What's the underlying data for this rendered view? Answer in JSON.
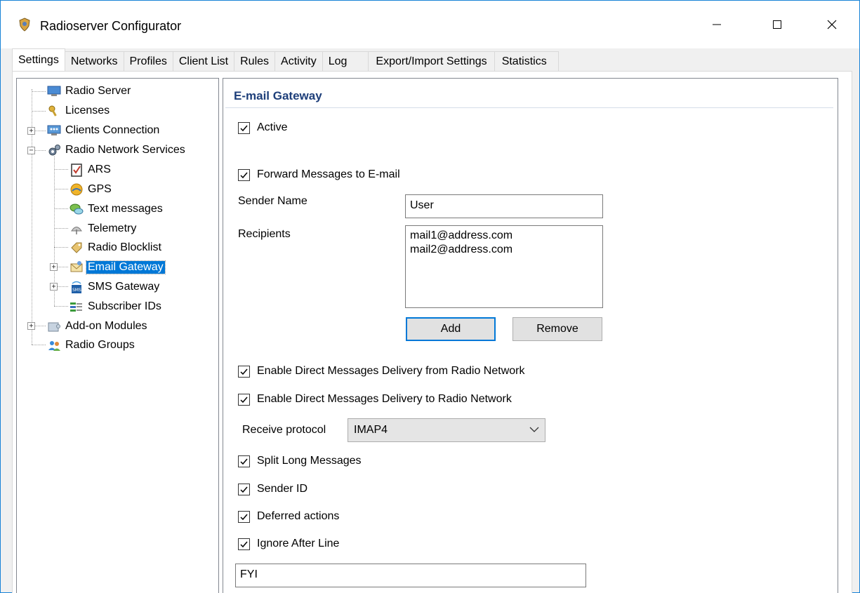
{
  "window": {
    "title": "Radioserver Configurator"
  },
  "tabs": [
    "Settings",
    "Networks",
    "Profiles",
    "Client List",
    "Rules",
    "Activity",
    "Log",
    "Export/Import Settings",
    "Statistics"
  ],
  "tree": {
    "radio_server": "Radio Server",
    "licenses": "Licenses",
    "clients_connection": "Clients Connection",
    "radio_network_services": "Radio Network Services",
    "ars": "ARS",
    "gps": "GPS",
    "text_messages": "Text messages",
    "telemetry": "Telemetry",
    "radio_blocklist": "Radio Blocklist",
    "email_gateway": "Email Gateway",
    "sms_gateway": "SMS Gateway",
    "subscriber_ids": "Subscriber IDs",
    "addon_modules": "Add-on Modules",
    "radio_groups": "Radio Groups"
  },
  "panel": {
    "title": "E-mail Gateway",
    "active_label": "Active",
    "forward_label": "Forward Messages to E-mail",
    "sender_name_label": "Sender Name",
    "sender_name_value": "User",
    "recipients_label": "Recipients",
    "recipients": [
      "mail1@address.com",
      "mail2@address.com"
    ],
    "add_label": "Add",
    "remove_label": "Remove",
    "direct_from_label": "Enable Direct Messages Delivery from Radio Network",
    "direct_to_label": "Enable Direct Messages Delivery to Radio Network",
    "receive_protocol_label": "Receive protocol",
    "receive_protocol_value": "IMAP4",
    "split_label": "Split Long Messages",
    "sender_id_label": "Sender ID",
    "deferred_label": "Deferred actions",
    "ignore_after_label": "Ignore After Line",
    "ignore_after_value": "FYI"
  },
  "colors": {
    "accent": "#0078d7",
    "section_title": "#1e3f7a",
    "window_border": "#1883d7"
  }
}
